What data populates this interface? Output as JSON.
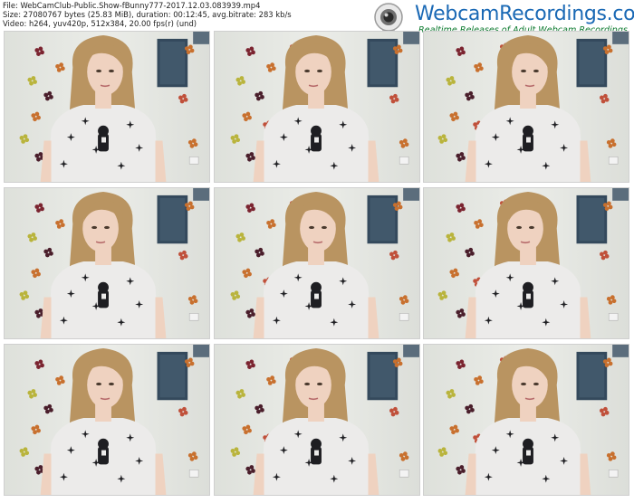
{
  "header": {
    "file_line": "File: WebCamClub-Public.Show-fBunny777-2017.12.03.083939.mp4",
    "size_line": "Size: 27080767 bytes (25.83 MiB), duration: 00:12:45, avg.bitrate: 283 kb/s",
    "video_line": "Video: h264, yuv420p, 512x384, 20.00 fps(r) (und)"
  },
  "logo": {
    "title": "WebcamRecordings.com",
    "tagline": "Realtime Releases of Adult Webcam Recordings",
    "icon": "webcam-icon"
  },
  "thumbnails": {
    "rows": 3,
    "cols": 3,
    "description_icon": "video-frame",
    "colors": {
      "wall": "#e6e8e3",
      "hair": "#b99461",
      "skin": "#efd2c0",
      "shirt": "#ecebea",
      "flowers": [
        "#7b2430",
        "#c8702e",
        "#b9b43c",
        "#4a1e2b",
        "#c0503a"
      ]
    }
  }
}
